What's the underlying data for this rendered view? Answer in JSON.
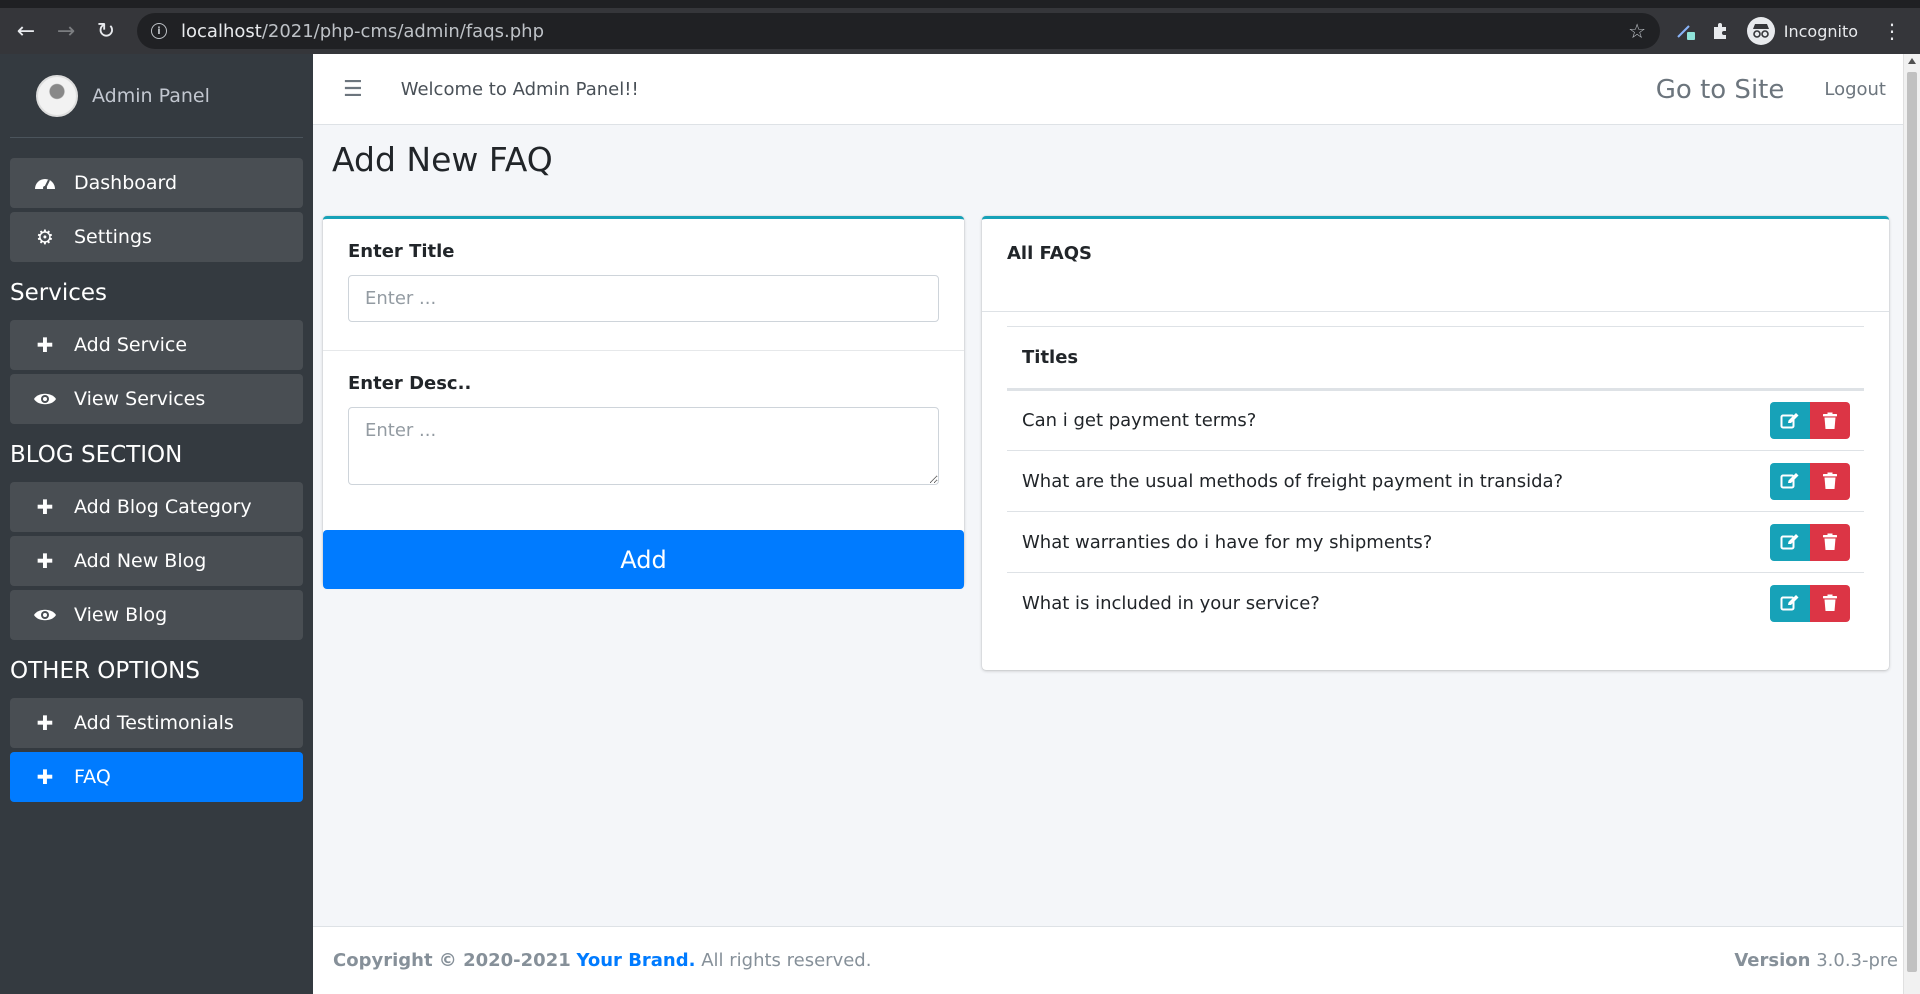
{
  "browser": {
    "url_host": "localhost",
    "url_path": "/2021/php-cms/admin/faqs.php",
    "profile_label": "Incognito"
  },
  "sidebar": {
    "brand_text": "Admin Panel",
    "items_top": [
      {
        "label": "Dashboard",
        "icon": "tachometer-icon"
      },
      {
        "label": "Settings",
        "icon": "gear-icon"
      }
    ],
    "section_services": "Services",
    "items_services": [
      {
        "label": "Add Service",
        "icon": "plus-icon"
      },
      {
        "label": "View Services",
        "icon": "eye-icon"
      }
    ],
    "section_blog": "BLOG SECTION",
    "items_blog": [
      {
        "label": "Add Blog Category",
        "icon": "plus-icon"
      },
      {
        "label": "Add New Blog",
        "icon": "plus-icon"
      },
      {
        "label": "View Blog",
        "icon": "eye-icon"
      }
    ],
    "section_other": "OTHER OPTIONS",
    "items_other": [
      {
        "label": "Add Testimonials",
        "icon": "plus-icon"
      },
      {
        "label": "FAQ",
        "icon": "plus-icon",
        "active": true
      }
    ]
  },
  "navbar": {
    "welcome": "Welcome to Admin Panel!!",
    "goto_site": "Go to Site",
    "logout": "Logout"
  },
  "page": {
    "title": "Add New FAQ"
  },
  "form": {
    "title_label": "Enter Title",
    "title_placeholder": "Enter ...",
    "desc_label": "Enter Desc..",
    "desc_placeholder": "Enter ...",
    "submit_label": "Add"
  },
  "faqs": {
    "header": "All FAQS",
    "column_title": "Titles",
    "rows": [
      "Can i get payment terms?",
      "What are the usual methods of freight payment in transida?",
      "What warranties do i have for my shipments?",
      "What is included in your service?"
    ]
  },
  "footer": {
    "copyright": "Copyright © 2020-2021",
    "brand": "Your Brand.",
    "rights": " All rights reserved.",
    "version_label": "Version",
    "version_value": " 3.0.3-pre"
  },
  "colors": {
    "primary": "#007bff",
    "info": "#17a2b8",
    "danger": "#dc3545",
    "sidebar": "#343a40"
  }
}
